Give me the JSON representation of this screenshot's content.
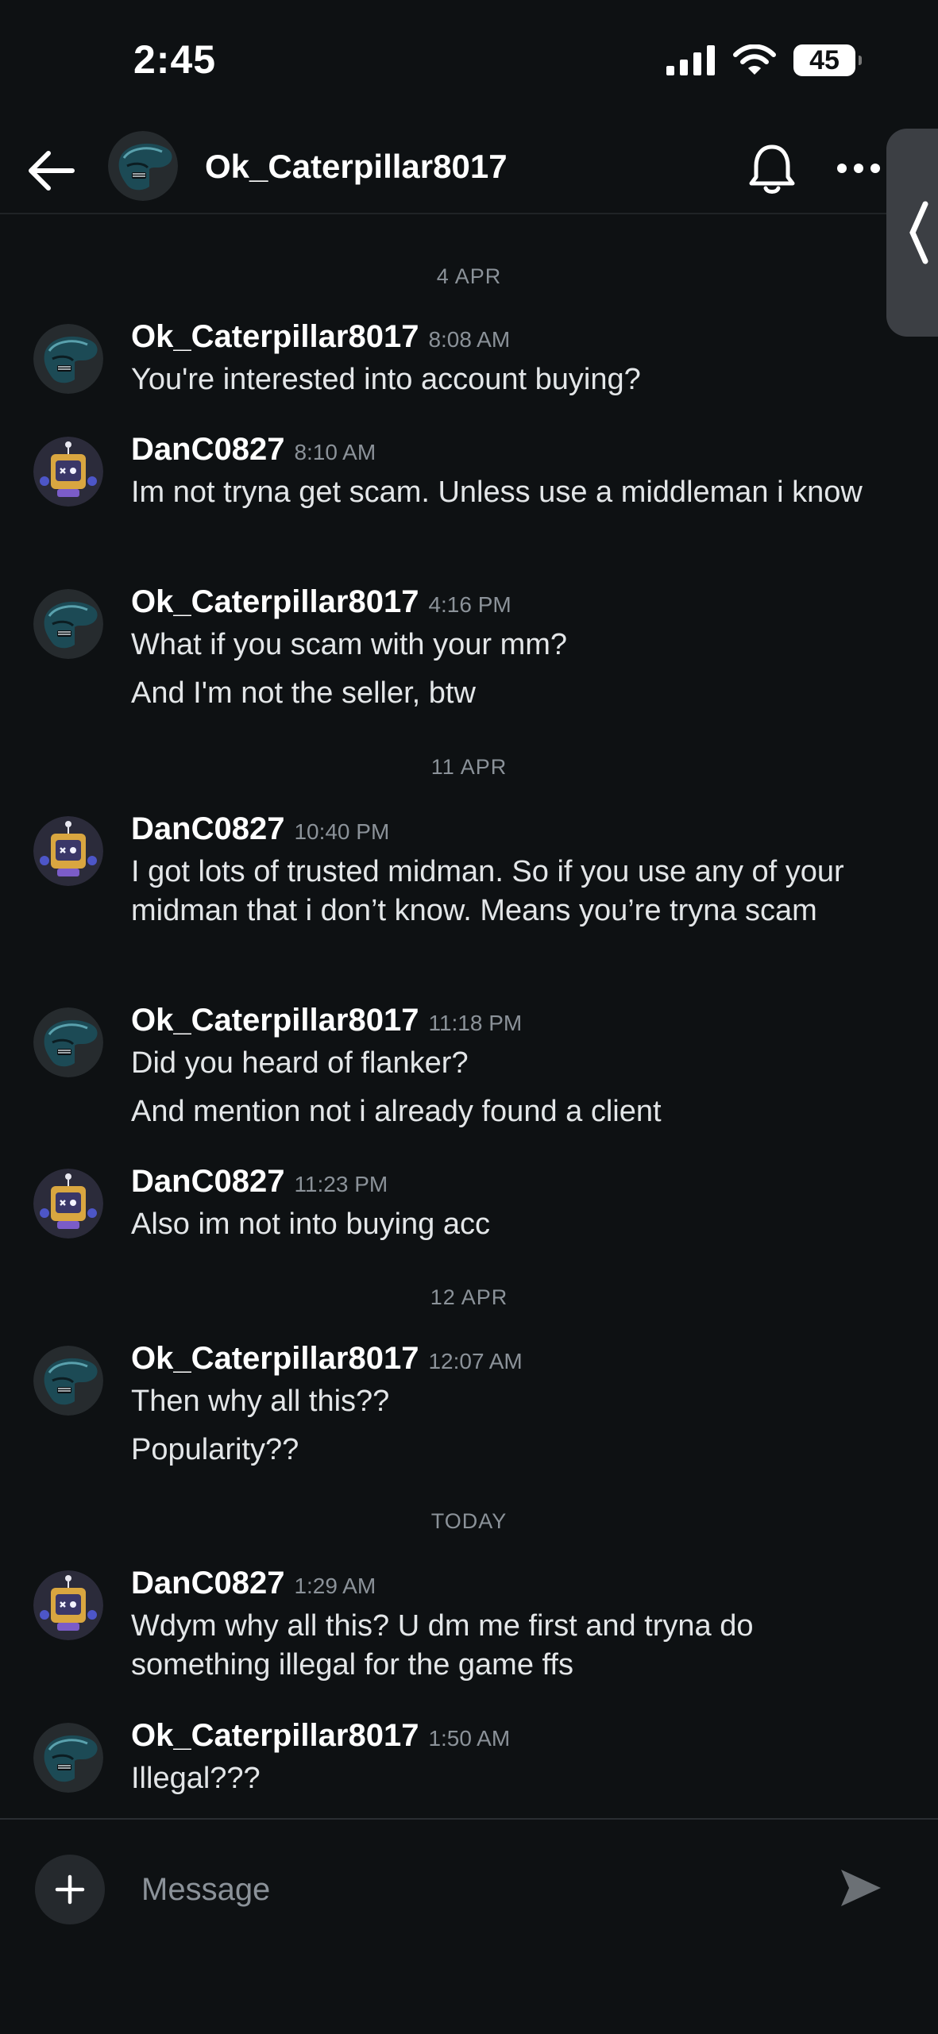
{
  "status_bar": {
    "time": "2:45",
    "battery": "45",
    "icons": [
      "cellular-signal-icon",
      "wifi-icon",
      "battery-icon"
    ]
  },
  "header": {
    "title": "Ok_Caterpillar8017",
    "icons": [
      "back-arrow-icon",
      "bell-icon",
      "more-icon"
    ]
  },
  "chat": {
    "dates": [
      "4 APR",
      "11 APR",
      "12 APR",
      "TODAY"
    ],
    "messages": [
      {
        "user": "Ok_Caterpillar8017",
        "time": "8:08 AM",
        "lines": [
          "You're interested into account buying?"
        ]
      },
      {
        "user": "DanC0827",
        "time": "8:10 AM",
        "lines": [
          "Im not tryna get scam. Unless use a middleman i know"
        ]
      },
      {
        "user": "Ok_Caterpillar8017",
        "time": "4:16 PM",
        "lines": [
          "What if you scam with your mm?",
          "And I'm not the seller, btw"
        ]
      },
      {
        "user": "DanC0827",
        "time": "10:40 PM",
        "lines": [
          "I got lots of trusted midman. So if you use any of your midman that i don’t know. Means you’re tryna scam"
        ]
      },
      {
        "user": "Ok_Caterpillar8017",
        "time": "11:18 PM",
        "lines": [
          "Did you heard of flanker?",
          "And mention not i already found a client"
        ]
      },
      {
        "user": "DanC0827",
        "time": "11:23 PM",
        "lines": [
          "Also im not into buying acc"
        ]
      },
      {
        "user": "Ok_Caterpillar8017",
        "time": "12:07 AM",
        "lines": [
          "Then why all this??",
          "Popularity??"
        ]
      },
      {
        "user": "DanC0827",
        "time": "1:29 AM",
        "lines": [
          "Wdym why all this? U dm me first and tryna do something illegal for the game ffs"
        ]
      },
      {
        "user": "Ok_Caterpillar8017",
        "time": "1:50 AM",
        "lines": [
          "Illegal???"
        ]
      }
    ]
  },
  "composer": {
    "placeholder": "Message",
    "icons": [
      "plus-icon",
      "send-icon"
    ]
  },
  "colors": {
    "background": "#0e1113",
    "text": "#e3e6e8",
    "muted": "#8b9299"
  }
}
